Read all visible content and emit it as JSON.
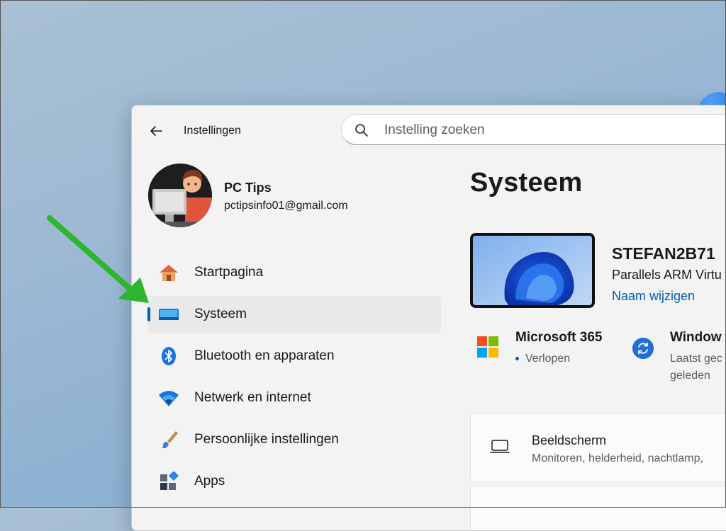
{
  "window": {
    "title": "Instellingen",
    "search_placeholder": "Instelling zoeken"
  },
  "profile": {
    "name": "PC Tips",
    "email": "pctipsinfo01@gmail.com"
  },
  "nav": {
    "items": [
      {
        "label": "Startpagina",
        "icon": "home-icon"
      },
      {
        "label": "Systeem",
        "icon": "display-icon",
        "active": true
      },
      {
        "label": "Bluetooth en apparaten",
        "icon": "bluetooth-icon"
      },
      {
        "label": "Netwerk en internet",
        "icon": "wifi-icon"
      },
      {
        "label": "Persoonlijke instellingen",
        "icon": "paintbrush-icon"
      },
      {
        "label": "Apps",
        "icon": "apps-icon"
      }
    ]
  },
  "main": {
    "heading": "Systeem",
    "device": {
      "name": "STEFAN2B71",
      "model": "Parallels ARM Virtu",
      "rename_link": "Naam wijzigen"
    },
    "microsoft365": {
      "title": "Microsoft 365",
      "status": "Verlopen"
    },
    "windows_update": {
      "title": "Window",
      "line1": "Laatst gec",
      "line2": "geleden"
    },
    "cards": [
      {
        "title": "Beeldscherm",
        "subtitle": "Monitoren, helderheid, nachtlamp,",
        "icon": "monitor-icon"
      }
    ]
  },
  "colors": {
    "accent": "#005fb8",
    "annotation_arrow": "#2db52d"
  }
}
